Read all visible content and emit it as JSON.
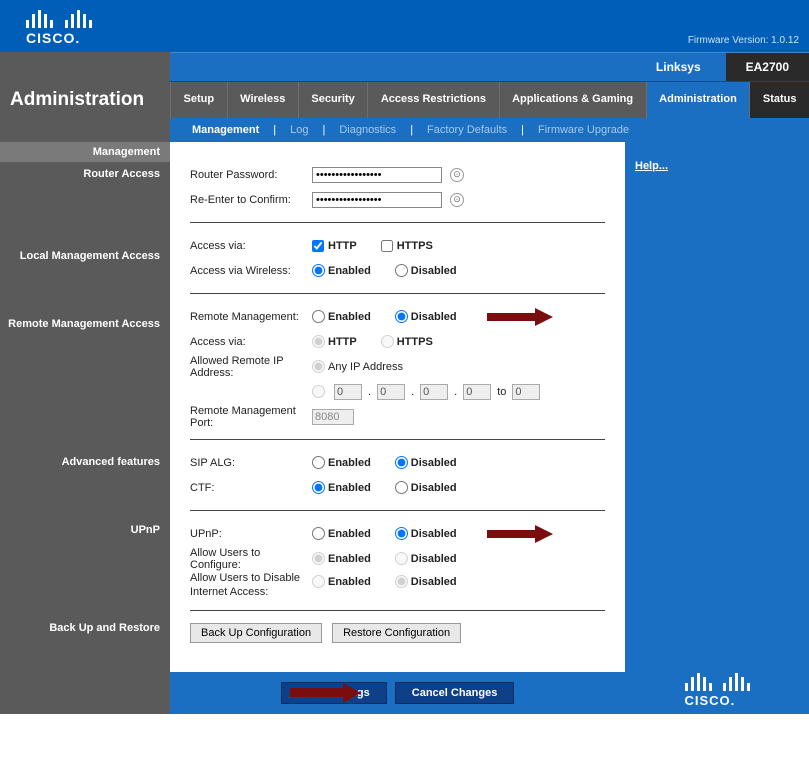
{
  "header": {
    "logo_text": "CISCO.",
    "firmware": "Firmware Version: 1.0.12",
    "brand": "Linksys",
    "model": "EA2700"
  },
  "page_title": "Administration",
  "tabs": [
    "Setup",
    "Wireless",
    "Security",
    "Access Restrictions",
    "Applications & Gaming",
    "Administration",
    "Status"
  ],
  "active_tab": "Administration",
  "subtabs": [
    "Management",
    "Log",
    "Diagnostics",
    "Factory Defaults",
    "Firmware Upgrade"
  ],
  "active_subtab": "Management",
  "help": "Help...",
  "sections": {
    "mgmt_header": "Management",
    "router_access": "Router Access",
    "local_mgmt": "Local Management Access",
    "remote_mgmt": "Remote Management Access",
    "advanced": "Advanced features",
    "upnp": "UPnP",
    "backup": "Back Up and Restore"
  },
  "labels": {
    "router_password": "Router Password:",
    "reenter": "Re-Enter to Confirm:",
    "access_via": "Access via:",
    "access_wireless": "Access via Wireless:",
    "remote_mgmt": "Remote  Management:",
    "allowed_ip": "Allowed Remote IP Address:",
    "remote_port": "Remote Management Port:",
    "sip_alg": "SIP ALG:",
    "ctf": "CTF:",
    "upnp": "UPnP:",
    "allow_config": "Allow Users to Configure:",
    "allow_disable": "Allow Users to Disable Internet Access:",
    "to": "to"
  },
  "options": {
    "http": "HTTP",
    "https": "HTTPS",
    "enabled": "Enabled",
    "disabled": "Disabled",
    "any_ip": "Any IP Address"
  },
  "values": {
    "password": "•••••••••••••••••",
    "ip1": "0",
    "ip2": "0",
    "ip3": "0",
    "ip4": "0",
    "ip_to": "0",
    "port": "8080"
  },
  "buttons": {
    "backup": "Back Up Configuration",
    "restore": "Restore Configuration",
    "save": "Save Settings",
    "cancel": "Cancel Changes"
  }
}
